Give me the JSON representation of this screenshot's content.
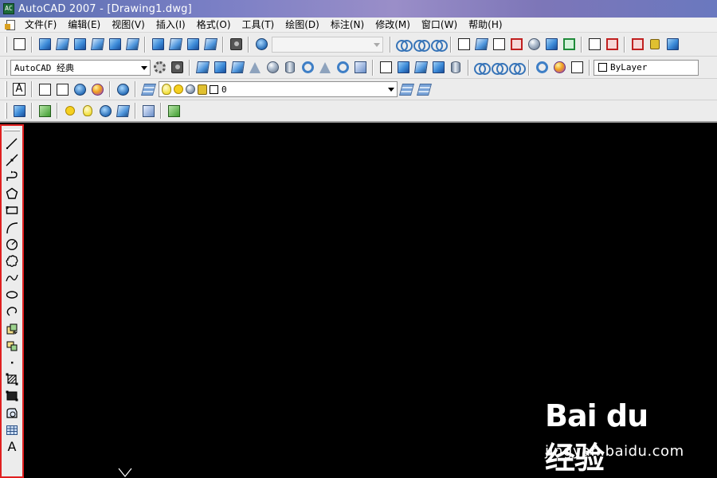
{
  "window": {
    "title": "AutoCAD 2007 - [Drawing1.dwg]",
    "app_icon_text": "AC"
  },
  "menu": [
    "文件(F)",
    "编辑(E)",
    "视图(V)",
    "插入(I)",
    "格式(O)",
    "工具(T)",
    "绘图(D)",
    "标注(N)",
    "修改(M)",
    "窗口(W)",
    "帮助(H)"
  ],
  "toolbar": {
    "workspace": "AutoCAD 经典",
    "linetype": "ByLayer",
    "layer": "0"
  },
  "draw_tools": [
    "line",
    "construction-line",
    "polyline",
    "polygon",
    "rectangle",
    "arc",
    "circle",
    "revision-cloud",
    "spline",
    "ellipse",
    "ellipse-arc",
    "insert-block",
    "make-block",
    "point",
    "hatch",
    "gradient",
    "region",
    "table",
    "multiline-text"
  ],
  "draw_text_label": "A",
  "watermark": {
    "brand": "Bai du 经验",
    "url": "jingyan.baidu.com"
  },
  "colors": {
    "highlight": "#e02020",
    "canvas": "#000000"
  }
}
